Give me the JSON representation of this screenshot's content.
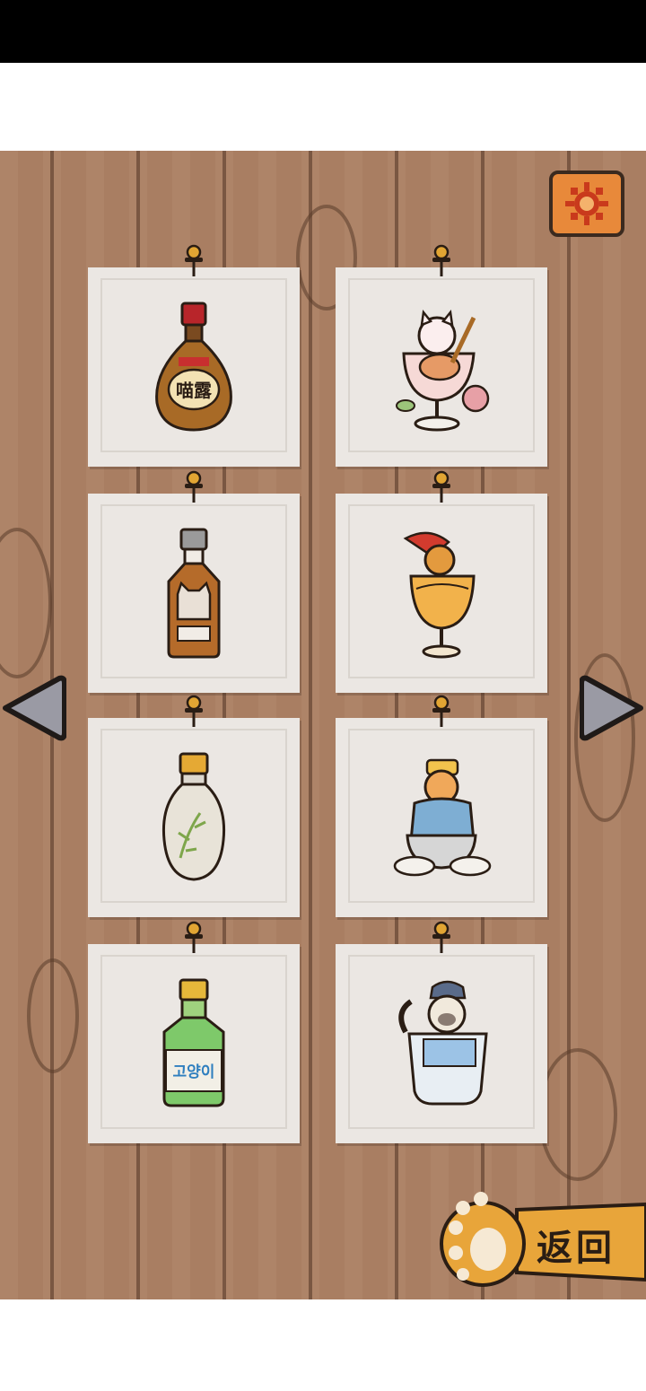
{
  "screen": {
    "colors": {
      "board": "#a97e62",
      "button_orange": "#e8893a",
      "card": "#ebe7e3"
    }
  },
  "header": {
    "settings_icon": "gear-icon"
  },
  "collection": {
    "items": [
      {
        "name": "bottle-meow-brandy",
        "label": "喵露",
        "icon": "brandy-bottle-icon"
      },
      {
        "name": "cat-cocktail-glass-rose",
        "icon": "cat-cocktail-icon"
      },
      {
        "name": "bottle-cat-whisky",
        "icon": "whisky-bottle-icon"
      },
      {
        "name": "cat-pirate-cocktail",
        "icon": "cat-cocktail-icon"
      },
      {
        "name": "bottle-bamboo-liquor",
        "icon": "bamboo-bottle-icon"
      },
      {
        "name": "cat-teacup-scholar",
        "icon": "cat-teacup-icon"
      },
      {
        "name": "bottle-goyangi-soju",
        "label": "고양이",
        "icon": "soju-bottle-icon"
      },
      {
        "name": "cat-glass-cap",
        "icon": "cat-glass-icon"
      }
    ]
  },
  "navigation": {
    "prev_icon": "arrow-left-icon",
    "next_icon": "arrow-right-icon",
    "back_label": "返回",
    "back_icon": "paw-icon"
  }
}
